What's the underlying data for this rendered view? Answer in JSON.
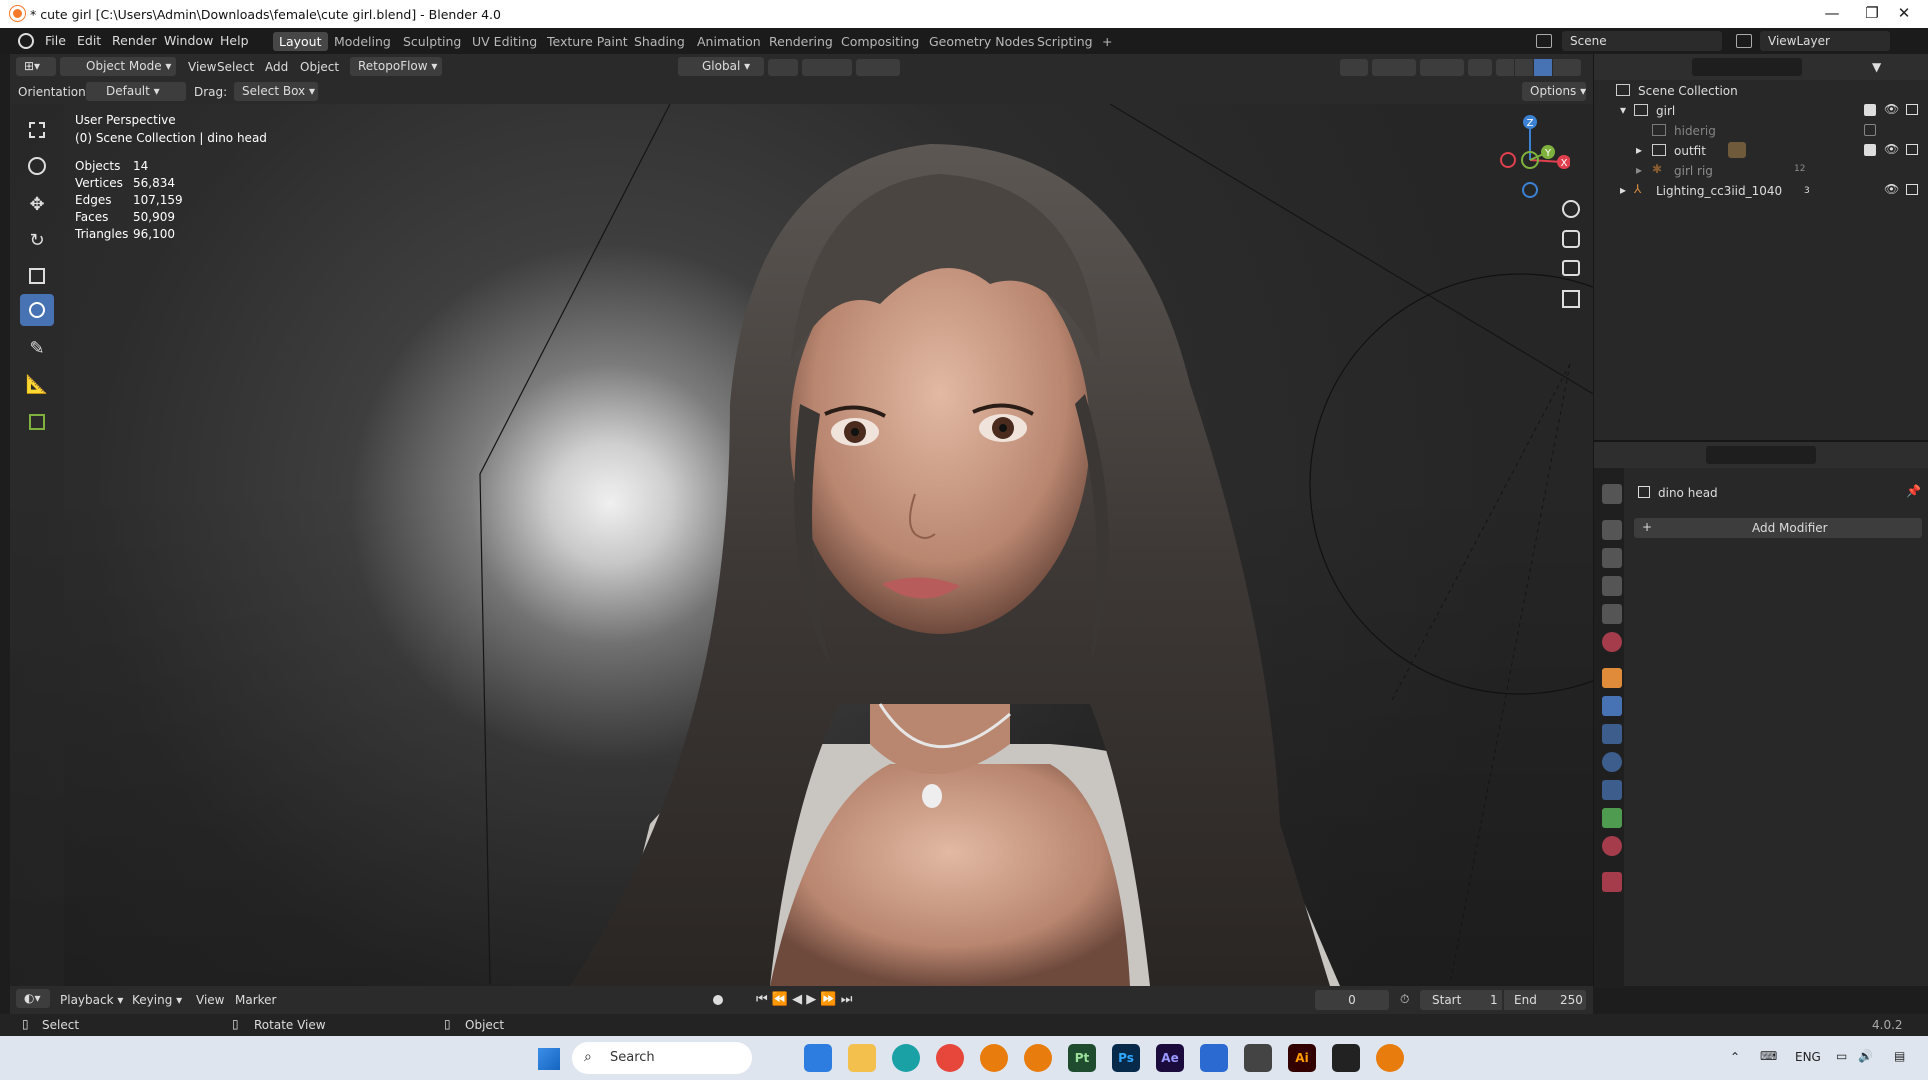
{
  "window": {
    "title": "* cute girl [C:\\Users\\Admin\\Downloads\\female\\cute girl.blend] - Blender 4.0",
    "minimize": "—",
    "maximize": "❐",
    "close": "✕"
  },
  "menu": [
    "File",
    "Edit",
    "Render",
    "Window",
    "Help"
  ],
  "workspaces": [
    "Layout",
    "Modeling",
    "Sculpting",
    "UV Editing",
    "Texture Paint",
    "Shading",
    "Animation",
    "Rendering",
    "Compositing",
    "Geometry Nodes",
    "Scripting",
    "+"
  ],
  "scene": {
    "label": "Scene",
    "viewlayer": "ViewLayer"
  },
  "viewport_header": {
    "mode": "Object Mode",
    "view": "View",
    "select": "Select",
    "add": "Add",
    "object": "Object",
    "addon": "RetopoFlow",
    "transform": "Global",
    "orientation_label": "Orientation:",
    "orientation_value": "Default",
    "drag_label": "Drag:",
    "drag_value": "Select Box",
    "options": "Options"
  },
  "overlay": {
    "perspective": "User Perspective",
    "collection": "(0) Scene Collection | dino head",
    "stats": [
      {
        "label": "Objects",
        "value": "14"
      },
      {
        "label": "Vertices",
        "value": "56,834"
      },
      {
        "label": "Edges",
        "value": "107,159"
      },
      {
        "label": "Faces",
        "value": "50,909"
      },
      {
        "label": "Triangles",
        "value": "96,100"
      }
    ]
  },
  "gizmo": {
    "x": "X",
    "y": "Y",
    "z": "Z"
  },
  "outliner": {
    "root": "Scene Collection",
    "items": [
      {
        "label": "girl"
      },
      {
        "label": "hiderig"
      },
      {
        "label": "outfit"
      },
      {
        "label": "girl rig",
        "badge": "12"
      },
      {
        "label": "Lighting_cc3iid_1040",
        "badge": "3"
      }
    ]
  },
  "properties": {
    "object_name": "dino head",
    "add_modifier": "Add Modifier"
  },
  "timeline": {
    "playback": "Playback",
    "keying": "Keying",
    "view": "View",
    "marker": "Marker",
    "current_frame": "0",
    "start_label": "Start",
    "start_value": "1",
    "end_label": "End",
    "end_value": "250"
  },
  "status": {
    "select": "Select",
    "rotate": "Rotate View",
    "object": "Object",
    "version": "4.0.2"
  },
  "taskbar": {
    "search": "Search",
    "lang": "ENG",
    "apps": [
      "Pt",
      "Ps",
      "Ae",
      "Ai"
    ]
  },
  "colors": {
    "accent": "#4772b3",
    "x_axis": "#e0404e",
    "y_axis": "#7fb13f",
    "z_axis": "#3b82d4"
  }
}
